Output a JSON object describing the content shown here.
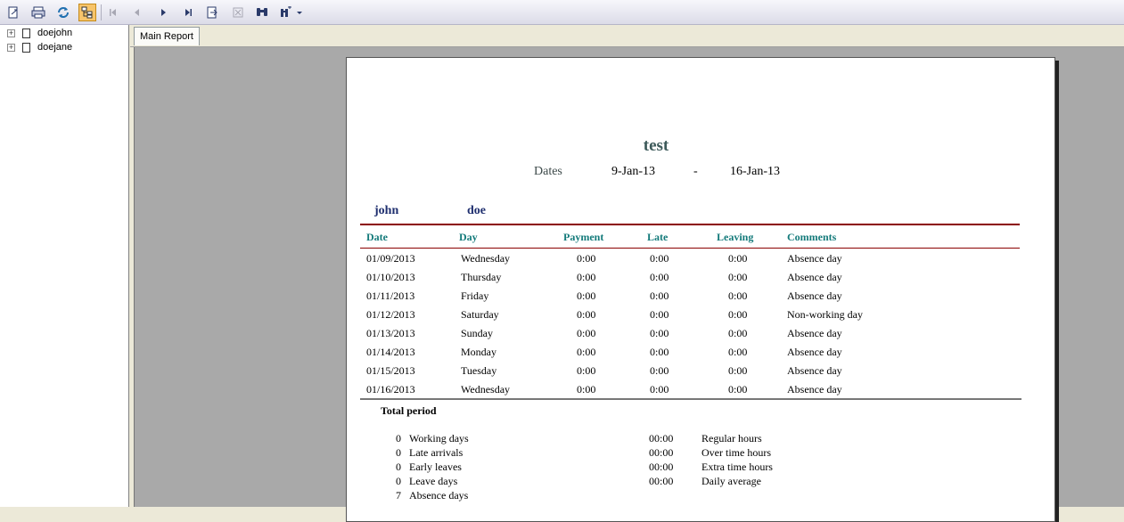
{
  "toolbar": {
    "buttons": [
      {
        "icon": "export-icon"
      },
      {
        "icon": "print-icon"
      },
      {
        "icon": "refresh-icon"
      },
      {
        "icon": "group-tree-icon",
        "active": true
      },
      {
        "icon": "first-page-icon",
        "disabled": true
      },
      {
        "icon": "previous-page-icon",
        "disabled": true
      },
      {
        "icon": "next-page-icon"
      },
      {
        "icon": "last-page-icon"
      },
      {
        "icon": "goto-page-icon"
      },
      {
        "icon": "stop-icon",
        "disabled": true
      },
      {
        "icon": "search-icon"
      },
      {
        "icon": "zoom-icon"
      }
    ]
  },
  "tree": {
    "items": [
      {
        "label": "doejohn"
      },
      {
        "label": "doejane"
      }
    ]
  },
  "tabs": [
    {
      "label": "Main Report"
    }
  ],
  "report": {
    "title": "test",
    "dates_label": "Dates",
    "date_from": "9-Jan-13",
    "date_separator": "-",
    "date_to": "16-Jan-13",
    "employee": {
      "first": "john",
      "last": "doe"
    },
    "columns": [
      "Date",
      "Day",
      "Payment",
      "Late",
      "Leaving",
      "Comments"
    ],
    "rows": [
      [
        "01/09/2013",
        "Wednesday",
        "0:00",
        "0:00",
        "0:00",
        "Absence day"
      ],
      [
        "01/10/2013",
        "Thursday",
        "0:00",
        "0:00",
        "0:00",
        "Absence day"
      ],
      [
        "01/11/2013",
        "Friday",
        "0:00",
        "0:00",
        "0:00",
        "Absence day"
      ],
      [
        "01/12/2013",
        "Saturday",
        "0:00",
        "0:00",
        "0:00",
        "Non-working day"
      ],
      [
        "01/13/2013",
        "Sunday",
        "0:00",
        "0:00",
        "0:00",
        "Absence day"
      ],
      [
        "01/14/2013",
        "Monday",
        "0:00",
        "0:00",
        "0:00",
        "Absence day"
      ],
      [
        "01/15/2013",
        "Tuesday",
        "0:00",
        "0:00",
        "0:00",
        "Absence day"
      ],
      [
        "01/16/2013",
        "Wednesday",
        "0:00",
        "0:00",
        "0:00",
        "Absence day"
      ]
    ],
    "total_title": "Total period",
    "summary_left": [
      {
        "count": "0",
        "label": "Working days"
      },
      {
        "count": "0",
        "label": "Late arrivals"
      },
      {
        "count": "0",
        "label": "Early leaves"
      },
      {
        "count": "0",
        "label": "Leave days"
      },
      {
        "count": "7",
        "label": "Absence days"
      }
    ],
    "summary_right": [
      {
        "value": "00:00",
        "label": "Regular hours"
      },
      {
        "value": "00:00",
        "label": "Over time hours"
      },
      {
        "value": "00:00",
        "label": "Extra time hours"
      },
      {
        "value": "00:00",
        "label": "Daily average"
      }
    ]
  },
  "colors": {
    "header_teal": "#137a7a",
    "rule_red": "#8b0000",
    "name_blue": "#1f2f6f",
    "viewer_gray": "#a9a9a9"
  }
}
